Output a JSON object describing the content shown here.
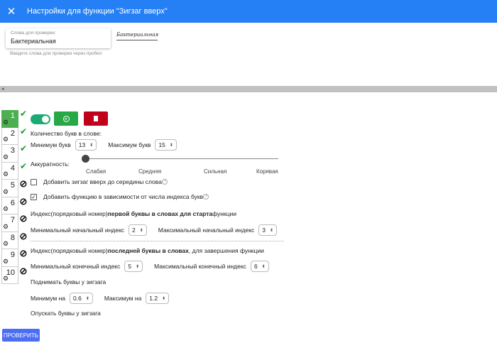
{
  "header": {
    "close_icon": "close-icon",
    "title": "Настройки для функции \"Зигзаг вверх\""
  },
  "words": {
    "label": "Слова для проверки:",
    "value": "Бактериальная",
    "hint": "Введите слова для проверки через пробел",
    "preview": "Бактериальная"
  },
  "sidebar": {
    "items": [
      {
        "n": "1",
        "status": "ok",
        "active": true
      },
      {
        "n": "2",
        "status": "ok"
      },
      {
        "n": "3",
        "status": "ok"
      },
      {
        "n": "4",
        "status": "ok"
      },
      {
        "n": "5",
        "status": "off"
      },
      {
        "n": "6",
        "status": "off"
      },
      {
        "n": "7",
        "status": "off"
      },
      {
        "n": "8",
        "status": "off"
      },
      {
        "n": "9",
        "status": "off"
      },
      {
        "n": "10",
        "status": "off"
      }
    ]
  },
  "toolbar": {
    "toggle_on": true,
    "add_icon": "plus-circle-icon",
    "delete_icon": "trash-icon",
    "add_color": "#28a745",
    "delete_color": "#c0001a"
  },
  "letters": {
    "title": "Количество букв в слове:",
    "min_label": "Минимум букв",
    "min": "13",
    "max_label": "Максимум букв",
    "max": "15"
  },
  "accuracy": {
    "label": "Аккуратность:",
    "ticks": [
      "Слабая",
      "Средняя",
      "Сильная",
      "Корявая"
    ],
    "value": "Слабая"
  },
  "options": [
    {
      "label": "Добавить зигзаг вверх до середины слова",
      "checked": false
    },
    {
      "label": "Добавить функцию в зависимости от числа индекса букв",
      "checked": true
    }
  ],
  "start": {
    "pre": "Индекс(порядковый номер) ",
    "bold": "первой буквы в словах для старта",
    "post": " функции",
    "min_label": "Минимальный начальный индекс",
    "min": "2",
    "max_label": "Максимальный начальный индекс",
    "max": "3"
  },
  "end": {
    "pre": "Индекс(порядковый номер) ",
    "bold": "последней буквы в словах",
    "post": ", для завершения функции",
    "min_label": "Минимальный конечный индекс",
    "min": "5",
    "max_label": "Максимальный конечный индекс",
    "max": "6"
  },
  "raise": {
    "title": "Поднимать буквы у зигзага",
    "min_label": "Минимум на",
    "min": "0.6",
    "max_label": "Максимум на",
    "max": "1.2"
  },
  "lower": {
    "title": "Опускать буквы у зигзага"
  },
  "check_button": "ПРОВЕРИТЬ"
}
